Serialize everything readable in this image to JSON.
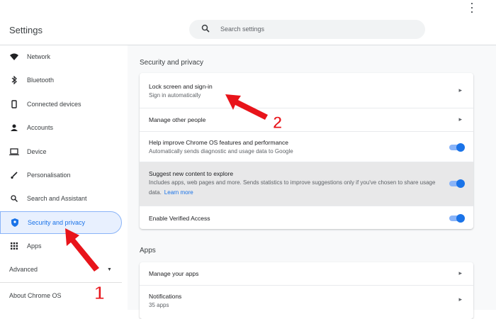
{
  "header": {
    "title": "Settings",
    "search_placeholder": "Search settings"
  },
  "sidebar": {
    "items": [
      {
        "label": "Network",
        "icon": "wifi-icon"
      },
      {
        "label": "Bluetooth",
        "icon": "bluetooth-icon"
      },
      {
        "label": "Connected devices",
        "icon": "phone-icon"
      },
      {
        "label": "Accounts",
        "icon": "person-icon"
      },
      {
        "label": "Device",
        "icon": "laptop-icon"
      },
      {
        "label": "Personalisation",
        "icon": "brush-icon"
      },
      {
        "label": "Search and Assistant",
        "icon": "search-icon"
      },
      {
        "label": "Security and privacy",
        "icon": "shield-icon",
        "selected": true
      },
      {
        "label": "Apps",
        "icon": "apps-grid-icon"
      }
    ],
    "advanced": "Advanced",
    "about": "About Chrome OS"
  },
  "security": {
    "title": "Security and privacy",
    "rows": [
      {
        "title": "Lock screen and sign-in",
        "subtitle": "Sign in automatically"
      },
      {
        "title": "Manage other people"
      },
      {
        "title": "Help improve Chrome OS features and performance",
        "subtitle": "Automatically sends diagnostic and usage data to Google",
        "toggle": true
      },
      {
        "title": "Suggest new content to explore",
        "subtitle": "Includes apps, web pages and more. Sends statistics to improve suggestions only if you've chosen to share usage data.",
        "link": "Learn more",
        "toggle": true
      },
      {
        "title": "Enable Verified Access",
        "toggle": true
      }
    ]
  },
  "apps": {
    "title": "Apps",
    "rows": [
      {
        "title": "Manage your apps"
      },
      {
        "title": "Notifications",
        "subtitle": "35 apps"
      }
    ]
  },
  "annotations": {
    "one": "1",
    "two": "2"
  },
  "colors": {
    "accent": "#1a73e8",
    "arrow": "#e8141a"
  }
}
